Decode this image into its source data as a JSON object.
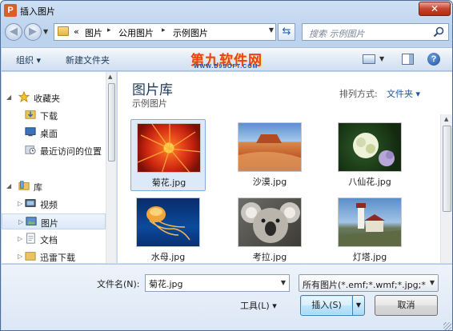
{
  "window": {
    "title": "插入图片",
    "app_icon_letter": "P",
    "close_glyph": "✕"
  },
  "address": {
    "prefix": "«",
    "parts": [
      "图片",
      "公用图片",
      "示例图片"
    ],
    "separator": "▸",
    "search_placeholder": "搜索 示例图片"
  },
  "toolbar": {
    "organize": "组织 ▾",
    "new_folder": "新建文件夹"
  },
  "watermark": {
    "main": "第九软件网",
    "sub": "WWW.D9SOFT.COM"
  },
  "navpane": {
    "favorites": "收藏夹",
    "downloads": "下载",
    "desktop": "桌面",
    "recent": "最近访问的位置",
    "libraries": "库",
    "videos": "视频",
    "pictures": "图片",
    "documents": "文档",
    "thunder": "迅雷下载"
  },
  "content": {
    "library_title": "图片库",
    "library_sub": "示例图片",
    "arrange_label": "排列方式:",
    "arrange_value": "文件夹 ▾",
    "files": [
      {
        "name": "菊花.jpg",
        "selected": true
      },
      {
        "name": "沙漠.jpg",
        "selected": false
      },
      {
        "name": "八仙花.jpg",
        "selected": false
      },
      {
        "name": "水母.jpg",
        "selected": false
      },
      {
        "name": "考拉.jpg",
        "selected": false
      },
      {
        "name": "灯塔.jpg",
        "selected": false
      }
    ]
  },
  "bottom": {
    "filename_label": "文件名(N):",
    "filename_value": "菊花.jpg",
    "filter_value": "所有图片(*.emf;*.wmf;*.jpg;*.j",
    "tools": "工具(L)  ▾",
    "insert": "插入(S)",
    "cancel": "取消"
  }
}
